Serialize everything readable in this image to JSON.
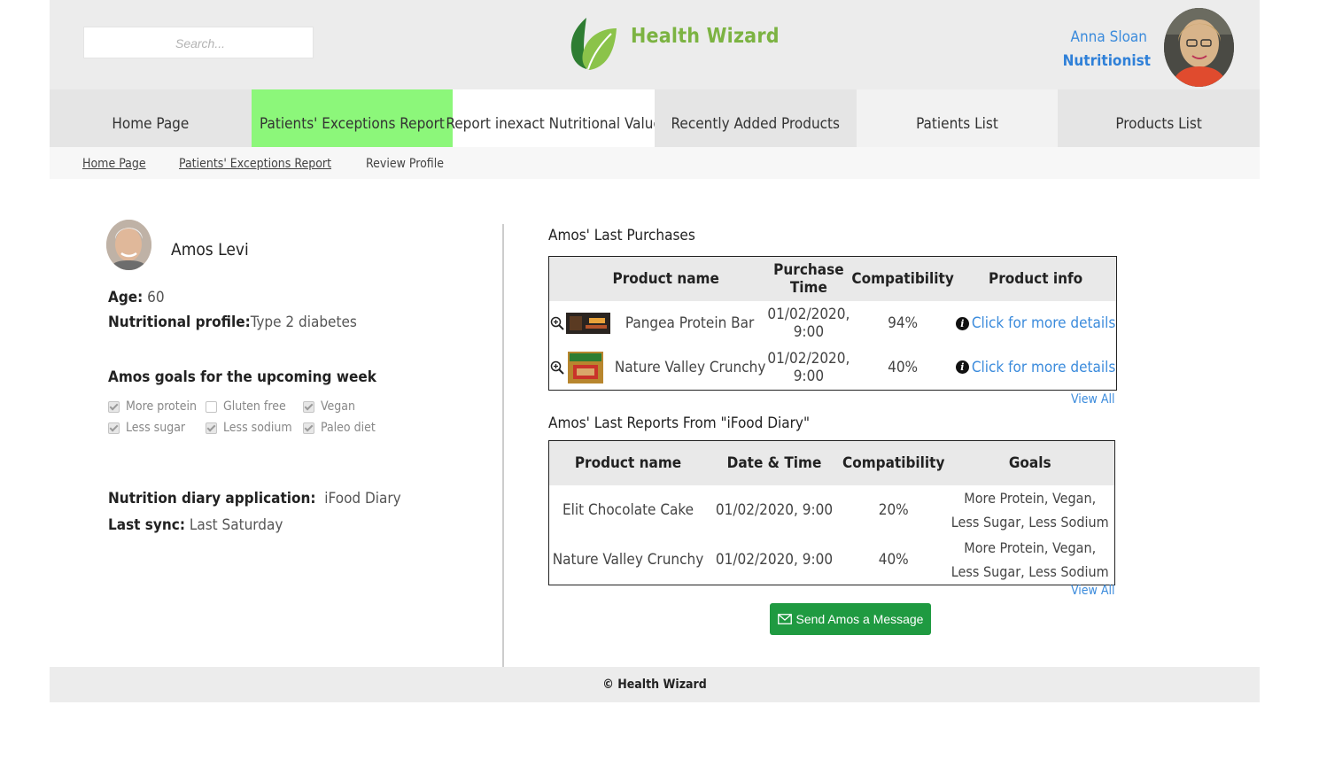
{
  "header": {
    "search_placeholder": "Search...",
    "brand": "Health Wizard",
    "user_name": "Anna Sloan",
    "user_role": "Nutritionist"
  },
  "nav": [
    {
      "label": "Home Page"
    },
    {
      "label": "Patients' Exceptions Report"
    },
    {
      "label": "Report inexact Nutritional Value"
    },
    {
      "label": "Recently Added Products"
    },
    {
      "label": "Patients List"
    },
    {
      "label": "Products List"
    }
  ],
  "breadcrumb": [
    "Home Page",
    "Patients' Exceptions Report",
    "Review Profile"
  ],
  "patient": {
    "name": "Amos Levi",
    "age_label": "Age:",
    "age": "60",
    "profile_label": "Nutritional profile:",
    "profile": "Type 2 diabetes",
    "goals_title": "Amos goals for the upcoming week",
    "goals": [
      {
        "label": "More protein",
        "checked": true
      },
      {
        "label": "Gluten free",
        "checked": false
      },
      {
        "label": "Vegan",
        "checked": true
      },
      {
        "label": "Less sugar",
        "checked": true
      },
      {
        "label": "Less sodium",
        "checked": true
      },
      {
        "label": "Paleo diet",
        "checked": true
      }
    ],
    "app_label": "Nutrition diary application:",
    "app": "iFood Diary",
    "sync_label": "Last sync:",
    "sync": "Last Saturday"
  },
  "purchases": {
    "title": "Amos' Last Purchases",
    "headers": [
      "Product name",
      "Purchase Time",
      "Compatibility",
      "Product info"
    ],
    "rows": [
      {
        "name": "Pangea Protein Bar",
        "time": "01/02/2020, 9:00",
        "compat": "94%",
        "info": "Click for more details"
      },
      {
        "name": "Nature Valley Crunchy",
        "time": "01/02/2020, 9:00",
        "compat": "40%",
        "info": "Click for more details"
      }
    ],
    "view_all": "View All"
  },
  "reports": {
    "title": "Amos' Last Reports From \"iFood Diary\"",
    "headers": [
      "Product name",
      "Date & Time",
      "Compatibility",
      "Goals"
    ],
    "rows": [
      {
        "name": "Elit Chocolate Cake",
        "time": "01/02/2020, 9:00",
        "compat": "20%",
        "goals1": "More Protein, Vegan,",
        "goals2": "Less Sugar, Less Sodium"
      },
      {
        "name": "Nature Valley Crunchy",
        "time": "01/02/2020, 9:00",
        "compat": "40%",
        "goals1": "More Protein, Vegan,",
        "goals2": "Less Sugar, Less Sodium"
      }
    ],
    "view_all": "View All"
  },
  "send_button": "Send Amos a Message",
  "footer": "© Health Wizard",
  "colors": {
    "brand": "#7cb342",
    "active_tab": "#8cf77a",
    "link": "#3b8bdc",
    "button": "#1f9a41"
  }
}
